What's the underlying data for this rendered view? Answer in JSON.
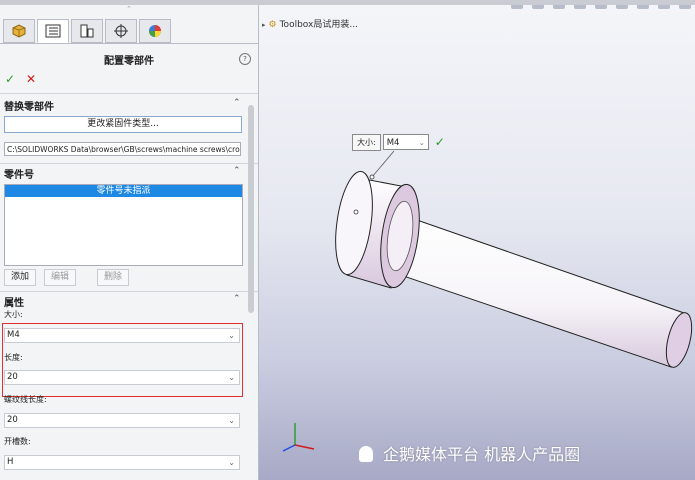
{
  "panel": {
    "title": "配置零部件",
    "help_glyph": "?",
    "ok_glyph": "✓",
    "cancel_glyph": "✕",
    "tabs": [
      "feature-manager",
      "property-manager",
      "configuration-manager",
      "dimxpert-manager",
      "display-manager"
    ]
  },
  "replace_section": {
    "heading": "替换零部件",
    "change_button": "更改紧固件类型...",
    "path": "C:\\SOLIDWORKS Data\\browser\\GB\\screws\\machine screws\\cros"
  },
  "part_number_section": {
    "heading": "零件号",
    "selected_item": "零件号未指派",
    "add_button": "添加",
    "edit_button": "编辑",
    "delete_button": "删除"
  },
  "properties_section": {
    "heading": "属性",
    "size_label": "大小:",
    "size_value": "M4",
    "length_label": "长度:",
    "length_value": "20",
    "thread_length_label": "螺纹线长度:",
    "thread_length_value": "20",
    "slot_label": "开槽数:",
    "slot_value": "H",
    "highlight_color": "#e0302c"
  },
  "viewport": {
    "tree_item": "Toolbox局试用装...",
    "popup_size_label": "大小:",
    "popup_size_value": "M4",
    "watermark": "企鹅媒体平台 机器人产品圈"
  },
  "colors": {
    "accent": "#1e88e5",
    "ok": "#2a9a2a",
    "cancel": "#d21c1c"
  }
}
